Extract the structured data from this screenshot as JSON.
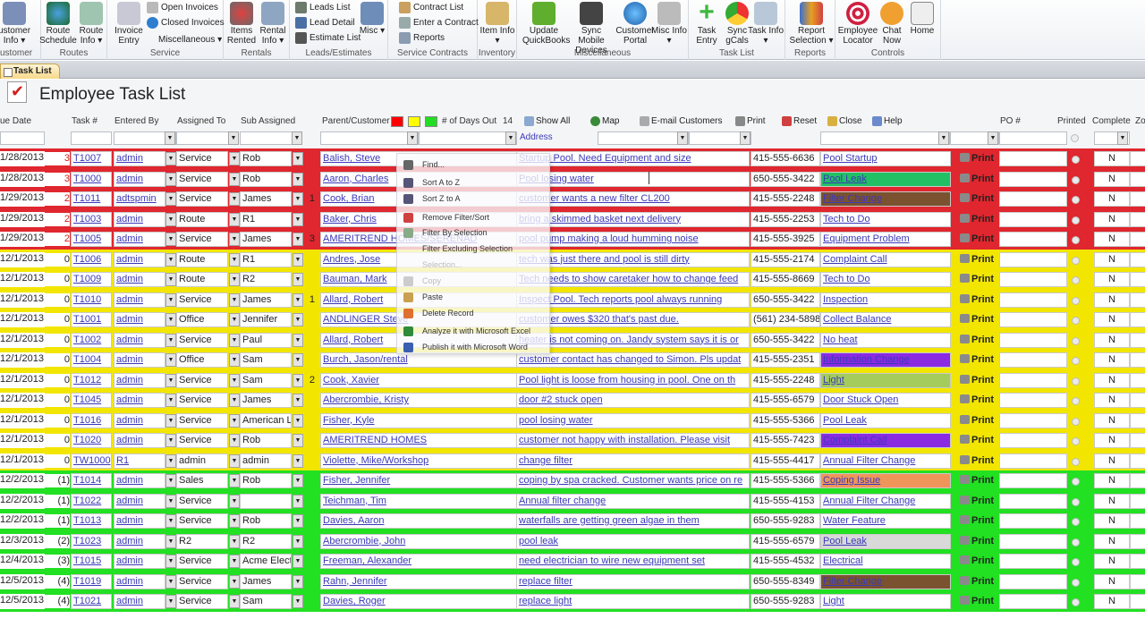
{
  "ribbon": {
    "groups": [
      {
        "label": "ustomer",
        "buttons": [
          {
            "label": "ustomer Info ▾",
            "icon": "customer-info-icon"
          }
        ]
      },
      {
        "label": "Routes",
        "buttons": [
          {
            "label": "Route Schedule",
            "icon": "route-schedule-globe-icon"
          },
          {
            "label": "Route Info ▾",
            "icon": "route-map-icon"
          }
        ]
      },
      {
        "label": "Service",
        "buttons": [
          {
            "label": "Invoice Entry",
            "icon": "invoice-entry-icon"
          }
        ],
        "small": [
          {
            "label": "Open Invoices",
            "icon": "open-invoices-icon"
          },
          {
            "label": "Closed Invoices",
            "icon": "closed-invoices-icon"
          },
          {
            "label": "Miscellaneous ▾",
            "icon": ""
          }
        ]
      },
      {
        "label": "Rentals",
        "buttons": [
          {
            "label": "Items Rented",
            "icon": "items-rented-icon"
          },
          {
            "label": "Rental Info ▾",
            "icon": "rental-info-icon"
          }
        ]
      },
      {
        "label": "Leads/Estimates",
        "small": [
          {
            "label": "Leads List",
            "icon": "leads-list-icon"
          },
          {
            "label": "Lead Detail",
            "icon": "lead-detail-icon"
          },
          {
            "label": "Estimate List",
            "icon": "estimate-list-icon"
          }
        ],
        "buttons": [
          {
            "label": "Misc ▾",
            "icon": "misc-icon"
          }
        ]
      },
      {
        "label": "Service Contracts",
        "small": [
          {
            "label": "Contract List",
            "icon": "contract-list-icon"
          },
          {
            "label": "Enter a Contract",
            "icon": "enter-contract-icon"
          },
          {
            "label": "Reports",
            "icon": "reports-icon"
          }
        ]
      },
      {
        "label": "Inventory",
        "buttons": [
          {
            "label": "Item Info ▾",
            "icon": "item-info-icon"
          }
        ]
      },
      {
        "label": "Miscellaneous",
        "buttons": [
          {
            "label": "Update QuickBooks",
            "icon": "update-quickbooks-icon"
          },
          {
            "label": "Sync Mobile Devices",
            "icon": "sync-mobile-icon"
          },
          {
            "label": "Customer Portal",
            "icon": "customer-portal-icon"
          },
          {
            "label": "Misc Info ▾",
            "icon": "tools-icon"
          }
        ]
      },
      {
        "label": "Task List",
        "buttons": [
          {
            "label": "Task Entry",
            "icon": "plus-icon"
          },
          {
            "label": "Sync gCals",
            "icon": "chrome-icon"
          },
          {
            "label": "Task Info ▾",
            "icon": "task-info-icon"
          }
        ]
      },
      {
        "label": "Reports",
        "buttons": [
          {
            "label": "Report Selection ▾",
            "icon": "report-selection-icon"
          }
        ]
      },
      {
        "label": "Controls",
        "buttons": [
          {
            "label": "Employee Locator",
            "icon": "target-icon"
          },
          {
            "label": "Chat Now",
            "icon": "chat-person-icon"
          },
          {
            "label": "Home",
            "icon": "home-icon"
          }
        ]
      }
    ]
  },
  "tab": {
    "label": "Task List"
  },
  "page_title": "Employee Task List",
  "header": {
    "due_date": "ue Date",
    "task_no": "Task #",
    "entered_by": "Entered By",
    "assigned_to": "Assigned To",
    "sub_assigned": "Sub Assigned",
    "parent_customer": "Parent/Customer",
    "days_out_label": "# of Days Out",
    "days_out_value": "14",
    "address": "Address",
    "po": "PO #",
    "printed": "Printed",
    "complete": "Complete",
    "zone": "Zo",
    "swatches": [
      "#ff0000",
      "#ffff00",
      "#22dd22"
    ],
    "actions": [
      {
        "label": "Show All",
        "icon": "show-all-icon"
      },
      {
        "label": "Map",
        "icon": "globe-icon"
      },
      {
        "label": "E-mail Customers",
        "icon": "email-icon"
      },
      {
        "label": "Print",
        "icon": "printer-icon"
      },
      {
        "label": "Reset",
        "icon": "reset-icon"
      },
      {
        "label": "Close",
        "icon": "close-door-icon"
      },
      {
        "label": "Help",
        "icon": "help-icon"
      }
    ]
  },
  "row_colors": {
    "red": "#e0262e",
    "yellow": "#f2e600",
    "green": "#22e022"
  },
  "rows": [
    {
      "band": "red",
      "date": "1/28/2013",
      "days": "3",
      "task": "T1007",
      "entered": "admin",
      "assigned": "Service",
      "sub": "Rob",
      "sub_n": "",
      "customer": "Balish, Steve",
      "desc": "Startup Pool.  Need Equipment and size",
      "phone": "415-555-6636",
      "type": "Pool Startup",
      "type_bg": "#ffffff",
      "print": "Print",
      "complete": "N"
    },
    {
      "band": "red",
      "date": "1/28/2013",
      "days": "3",
      "task": "T1000",
      "entered": "admin",
      "assigned": "Service",
      "sub": "Rob",
      "sub_n": "",
      "customer": "Aaron, Charles",
      "desc": "Pool losing water",
      "phone": "650-555-3422",
      "type": "Pool Leak",
      "type_bg": "#22c064",
      "print": "Print",
      "complete": "N"
    },
    {
      "band": "red",
      "date": "1/29/2013",
      "days": "2",
      "task": "T1011",
      "entered": "adtspmin",
      "assigned": "Service",
      "sub": "James",
      "sub_n": "1",
      "customer": "Cook, Brian",
      "desc": "customer wants a new filter CL200",
      "phone": "415-555-2248",
      "type": "Filter Change",
      "type_bg": "#7a5230",
      "print": "Print",
      "complete": "N"
    },
    {
      "band": "red",
      "date": "1/29/2013",
      "days": "2",
      "task": "T1003",
      "entered": "admin",
      "assigned": "Route",
      "sub": "R1",
      "sub_n": "",
      "customer": "Baker, Chris",
      "desc": "bring a skimmed basket next delivery",
      "phone": "415-555-2253",
      "type": "Tech to Do",
      "type_bg": "#ffffff",
      "print": "Print",
      "complete": "N"
    },
    {
      "band": "red",
      "date": "1/29/2013",
      "days": "2",
      "task": "T1005",
      "entered": "admin",
      "assigned": "Service",
      "sub": "James",
      "sub_n": "3",
      "customer": "AMERITREND HOMES/SERENAD",
      "desc": "pool pump making a loud humming noise",
      "phone": "415-555-3925",
      "type": "Equipment Problem",
      "type_bg": "#ffffff",
      "print": "Print",
      "complete": "N"
    },
    {
      "band": "yellow",
      "date": "12/1/2013",
      "days": "0",
      "task": "T1006",
      "entered": "admin",
      "assigned": "Route",
      "sub": "R1",
      "sub_n": "",
      "customer": "Andres, Jose",
      "desc": "tech was just there and pool is still dirty",
      "phone": "415-555-2174",
      "type": "Complaint Call",
      "type_bg": "#ffffff",
      "print": "Print",
      "complete": "N"
    },
    {
      "band": "yellow",
      "date": "12/1/2013",
      "days": "0",
      "task": "T1009",
      "entered": "admin",
      "assigned": "Route",
      "sub": "R2",
      "sub_n": "",
      "customer": "Bauman, Mark",
      "desc": "Tech needs to show caretaker how to change feed",
      "phone": "415-555-8669",
      "type": "Tech to Do",
      "type_bg": "#ffffff",
      "print": "Print",
      "complete": "N"
    },
    {
      "band": "yellow",
      "date": "12/1/2013",
      "days": "0",
      "task": "T1010",
      "entered": "admin",
      "assigned": "Service",
      "sub": "James",
      "sub_n": "1",
      "customer": "Allard, Robert",
      "desc": "Inspect Pool.  Tech reports pool always running",
      "phone": "650-555-3422",
      "type": "Inspection",
      "type_bg": "#ffffff",
      "print": "Print",
      "complete": "N"
    },
    {
      "band": "yellow",
      "date": "12/1/2013",
      "days": "0",
      "task": "T1001",
      "entered": "admin",
      "assigned": "Office",
      "sub": "Jennifer",
      "sub_n": "",
      "customer": "ANDLINGER Steve",
      "desc": "customer owes $320 that's past due.",
      "phone": "(561) 234-5898",
      "type": "Collect Balance",
      "type_bg": "#ffffff",
      "print": "Print",
      "complete": "N"
    },
    {
      "band": "yellow",
      "date": "12/1/2013",
      "days": "0",
      "task": "T1002",
      "entered": "admin",
      "assigned": "Service",
      "sub": "Paul",
      "sub_n": "",
      "customer": "Allard, Robert",
      "desc": "heater is not coming on.  Jandy system says it is or",
      "phone": "650-555-3422",
      "type": "No heat",
      "type_bg": "#ffffff",
      "print": "Print",
      "complete": "N"
    },
    {
      "band": "yellow",
      "date": "12/1/2013",
      "days": "0",
      "task": "T1004",
      "entered": "admin",
      "assigned": "Office",
      "sub": "Sam",
      "sub_n": "",
      "customer": "Burch, Jason/rental",
      "desc": "customer contact has changed to Simon.  Pls updat",
      "phone": "415-555-2351",
      "type": "Information Change",
      "type_bg": "#8a2be2",
      "print": "Print",
      "complete": "N"
    },
    {
      "band": "yellow",
      "date": "12/1/2013",
      "days": "0",
      "task": "T1012",
      "entered": "admin",
      "assigned": "Service",
      "sub": "Sam",
      "sub_n": "2",
      "customer": "Cook, Xavier",
      "desc": "Pool light is loose from housing in pool.  One on th",
      "phone": "415-555-2248",
      "type": "Light",
      "type_bg": "#a3cc5c",
      "print": "Print",
      "complete": "N"
    },
    {
      "band": "yellow",
      "date": "12/1/2013",
      "days": "0",
      "task": "T1045",
      "entered": "admin",
      "assigned": "Service",
      "sub": "James",
      "sub_n": "",
      "customer": "Abercrombie, Kristy",
      "desc": "door #2 stuck open",
      "phone": "415-555-6579",
      "type": "Door Stuck Open",
      "type_bg": "#ffffff",
      "print": "Print",
      "complete": "N"
    },
    {
      "band": "yellow",
      "date": "12/1/2013",
      "days": "0",
      "task": "T1016",
      "entered": "admin",
      "assigned": "Service",
      "sub": "American L",
      "sub_n": "",
      "customer": "Fisher, Kyle",
      "desc": "pool losing water",
      "phone": "415-555-5366",
      "type": "Pool Leak",
      "type_bg": "#ffffff",
      "print": "Print",
      "complete": "N"
    },
    {
      "band": "yellow",
      "date": "12/1/2013",
      "days": "0",
      "task": "T1020",
      "entered": "admin",
      "assigned": "Service",
      "sub": "Rob",
      "sub_n": "",
      "customer": "AMERITREND HOMES",
      "desc": "customer not happy with installation.  Please visit",
      "phone": "415-555-7423",
      "type": "Complaint Call",
      "type_bg": "#8a2be2",
      "print": "Print",
      "complete": "N"
    },
    {
      "band": "yellow",
      "date": "12/1/2013",
      "days": "0",
      "task": "TW1000",
      "entered": "R1",
      "assigned": "admin",
      "sub": "admin",
      "sub_n": "",
      "customer": "Violette, Mike/Workshop",
      "desc": "change filter",
      "phone": "415-555-4417",
      "type": "Annual Filter Change",
      "type_bg": "#ffffff",
      "print": "Print",
      "complete": "N"
    },
    {
      "band": "green",
      "date": "12/2/2013",
      "days": "(1)",
      "task": "T1014",
      "entered": "admin",
      "assigned": "Sales",
      "sub": "Rob",
      "sub_n": "",
      "customer": "Fisher, Jennifer",
      "desc": "coping by spa cracked.  Customer wants price on re",
      "phone": "415-555-5366",
      "type": "Coping Issue",
      "type_bg": "#f0955a",
      "print": "Print",
      "complete": "N"
    },
    {
      "band": "green",
      "date": "12/2/2013",
      "days": "(1)",
      "task": "T1022",
      "entered": "admin",
      "assigned": "Service",
      "sub": "",
      "sub_n": "",
      "customer": "Teichman, Tim",
      "desc": "Annual filter change",
      "phone": "415-555-4153",
      "type": "Annual Filter Change",
      "type_bg": "#ffffff",
      "print": "Print",
      "complete": "N"
    },
    {
      "band": "green",
      "date": "12/2/2013",
      "days": "(1)",
      "task": "T1013",
      "entered": "admin",
      "assigned": "Service",
      "sub": "Rob",
      "sub_n": "",
      "customer": "Davies, Aaron",
      "desc": "waterfalls are getting green algae in them",
      "phone": "650-555-9283",
      "type": "Water Feature",
      "type_bg": "#ffffff",
      "print": "Print",
      "complete": "N"
    },
    {
      "band": "green",
      "date": "12/3/2013",
      "days": "(2)",
      "task": "T1023",
      "entered": "admin",
      "assigned": "R2",
      "sub": "R2",
      "sub_n": "",
      "customer": "Abercrombie, John",
      "desc": "pool leak",
      "phone": "415-555-6579",
      "type": "Pool Leak",
      "type_bg": "#d9d9d9",
      "print": "Print",
      "complete": "N"
    },
    {
      "band": "green",
      "date": "12/4/2013",
      "days": "(3)",
      "task": "T1015",
      "entered": "admin",
      "assigned": "Service",
      "sub": "Acme Elect",
      "sub_n": "",
      "customer": "Freeman, Alexander",
      "desc": "need electrician to wire new equipment set",
      "phone": "415-555-4532",
      "type": "Electrical",
      "type_bg": "#ffffff",
      "print": "Print",
      "complete": "N"
    },
    {
      "band": "green",
      "date": "12/5/2013",
      "days": "(4)",
      "task": "T1019",
      "entered": "admin",
      "assigned": "Service",
      "sub": "James",
      "sub_n": "",
      "customer": "Rahn, Jennifer",
      "desc": "replace filter",
      "phone": "650-555-8349",
      "type": "Filter Change",
      "type_bg": "#7a5230",
      "print": "Print",
      "complete": "N"
    },
    {
      "band": "green",
      "date": "12/5/2013",
      "days": "(4)",
      "task": "T1021",
      "entered": "admin",
      "assigned": "Service",
      "sub": "Sam",
      "sub_n": "",
      "customer": "Davies, Roger",
      "desc": "replace light",
      "phone": "650-555-9283",
      "type": "Light",
      "type_bg": "#ffffff",
      "print": "Print",
      "complete": "N"
    }
  ],
  "context_menu": {
    "items": [
      {
        "label": "Find...",
        "icon": "binoculars-icon",
        "disabled": false
      },
      {
        "label": "Sort A to Z",
        "icon": "sort-asc-icon",
        "disabled": false
      },
      {
        "label": "Sort Z to A",
        "icon": "sort-desc-icon",
        "disabled": false
      },
      {
        "label": "Remove Filter/Sort",
        "icon": "remove-filter-icon",
        "disabled": false
      },
      {
        "label": "Filter By Selection",
        "icon": "filter-icon",
        "disabled": false
      },
      {
        "label": "Filter Excluding Selection",
        "icon": "",
        "disabled": false
      },
      {
        "label": "Selection...",
        "icon": "",
        "disabled": true
      },
      {
        "label": "Copy",
        "icon": "copy-icon",
        "disabled": true
      },
      {
        "label": "Paste",
        "icon": "paste-icon",
        "disabled": false
      },
      {
        "label": "Delete Record",
        "icon": "delete-record-icon",
        "disabled": false
      },
      {
        "label": "Analyze it with Microsoft Excel",
        "icon": "excel-icon",
        "disabled": false
      },
      {
        "label": "Publish it with Microsoft Word",
        "icon": "word-icon",
        "disabled": false
      }
    ]
  }
}
